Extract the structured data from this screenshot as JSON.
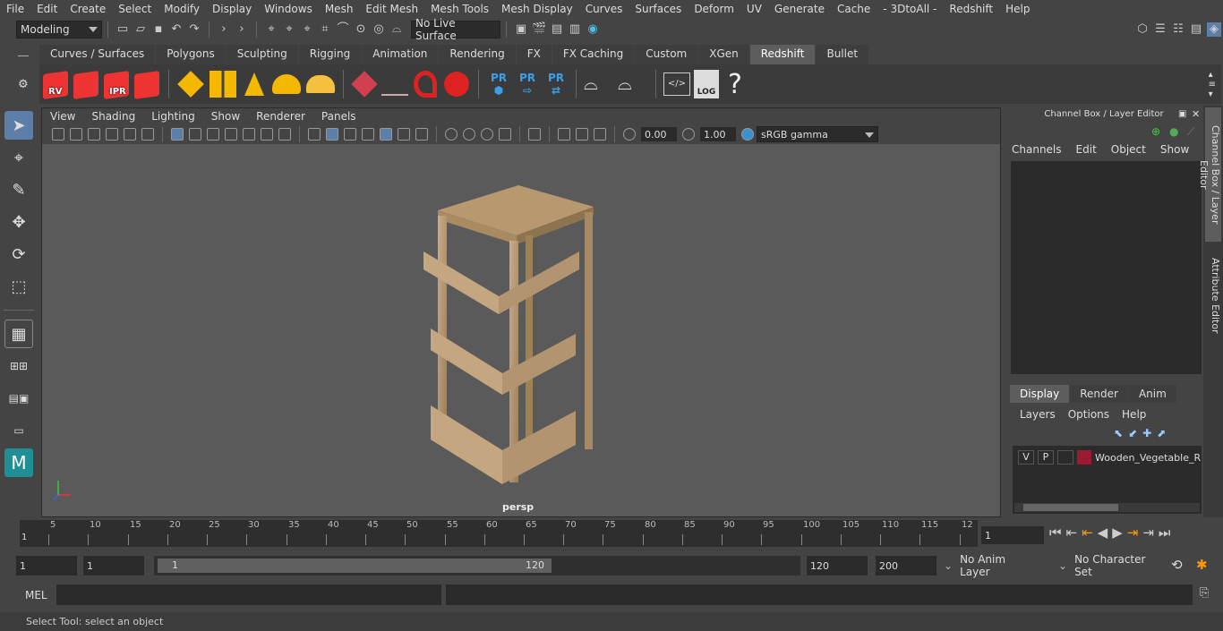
{
  "menubar": [
    "File",
    "Edit",
    "Create",
    "Select",
    "Modify",
    "Display",
    "Windows",
    "Mesh",
    "Edit Mesh",
    "Mesh Tools",
    "Mesh Display",
    "Curves",
    "Surfaces",
    "Deform",
    "UV",
    "Generate",
    "Cache",
    "- 3DtoAll -",
    "Redshift",
    "Help"
  ],
  "status": {
    "mode": "Modeling",
    "live_surface": "No Live Surface"
  },
  "shelf_tabs": [
    "Curves / Surfaces",
    "Polygons",
    "Sculpting",
    "Rigging",
    "Animation",
    "Rendering",
    "FX",
    "FX Caching",
    "Custom",
    "XGen",
    "Redshift",
    "Bullet"
  ],
  "shelf_active": "Redshift",
  "shelf_icons": {
    "rv": "RV",
    "ipr": "IPR",
    "pr": "PR",
    "log": "LOG",
    "help": "?"
  },
  "viewport": {
    "menu": [
      "View",
      "Shading",
      "Lighting",
      "Show",
      "Renderer",
      "Panels"
    ],
    "exposure": "0.00",
    "gamma": "1.00",
    "colorspace": "sRGB gamma",
    "camera": "persp"
  },
  "channel_box": {
    "title": "Channel Box / Layer Editor",
    "menu": [
      "Channels",
      "Edit",
      "Object",
      "Show"
    ],
    "layer_tabs": [
      "Display",
      "Render",
      "Anim"
    ],
    "layer_tab_active": "Display",
    "layer_menu": [
      "Layers",
      "Options",
      "Help"
    ],
    "layer": {
      "v": "V",
      "p": "P",
      "name": "Wooden_Vegetable_R",
      "color": "#9b1b30"
    }
  },
  "side_tabs": [
    "Channel Box / Layer Editor",
    "Attribute Editor"
  ],
  "timeline": {
    "ticks": [
      "5",
      "10",
      "15",
      "20",
      "25",
      "30",
      "35",
      "40",
      "45",
      "50",
      "55",
      "60",
      "65",
      "70",
      "75",
      "80",
      "85",
      "90",
      "95",
      "100",
      "105",
      "110",
      "115",
      "12"
    ],
    "start_marker": "1",
    "current_frame": "1"
  },
  "range": {
    "start": "1",
    "playback_start": "1",
    "slider_start": "1",
    "slider_end": "120",
    "playback_end": "120",
    "end": "200",
    "anim_layer": "No Anim Layer",
    "char_set": "No Character Set"
  },
  "command": {
    "lang": "MEL"
  },
  "help_line": "Select Tool: select an object"
}
